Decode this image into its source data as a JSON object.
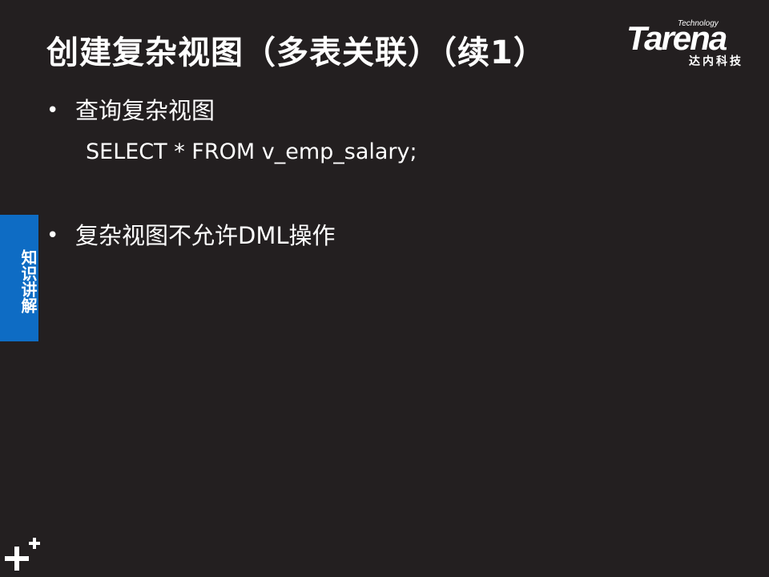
{
  "slide": {
    "title": "创建复杂视图（多表关联）（续1）",
    "logo": {
      "technology": "Technology",
      "brand": "Tarena",
      "chinese": "达内科技"
    },
    "bullets": [
      {
        "marker": "•",
        "text": "查询复杂视图"
      },
      {
        "marker": "•",
        "text": "复杂视图不允许DML操作"
      }
    ],
    "code": "SELECT * FROM v_emp_salary;",
    "side_tab": {
      "label": "知识讲解"
    },
    "corner_icon": "plus-plus-icon",
    "colors": {
      "background": "#231f20",
      "text": "#ffffff",
      "tab": "#0e6cc4"
    }
  }
}
